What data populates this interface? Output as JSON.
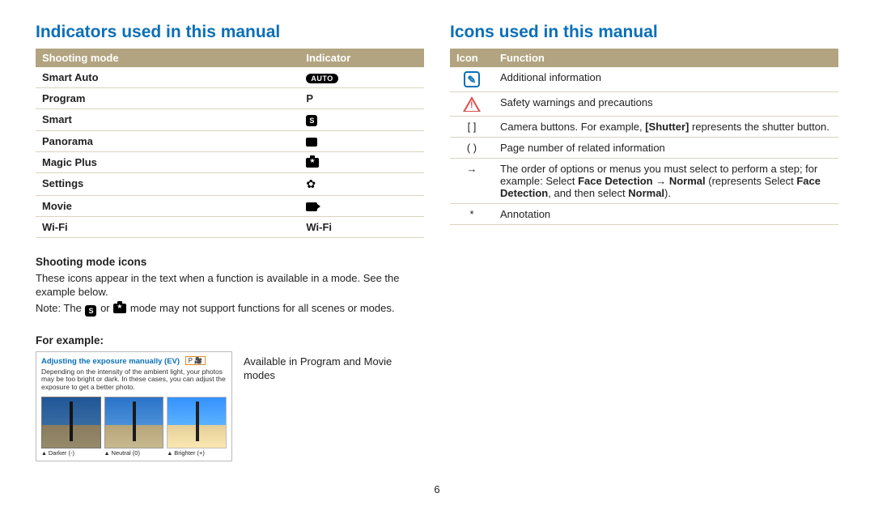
{
  "page_number": "6",
  "left": {
    "title": "Indicators used in this manual",
    "table_headers": {
      "c1": "Shooting mode",
      "c2": "Indicator"
    },
    "rows": [
      {
        "mode": "Smart Auto",
        "indicator_type": "auto",
        "indicator_text": "AUTO"
      },
      {
        "mode": "Program",
        "indicator_type": "text",
        "indicator_text": "P"
      },
      {
        "mode": "Smart",
        "indicator_type": "s-icon",
        "indicator_text": "S"
      },
      {
        "mode": "Panorama",
        "indicator_type": "pano-icon"
      },
      {
        "mode": "Magic Plus",
        "indicator_type": "camera-icon"
      },
      {
        "mode": "Settings",
        "indicator_type": "gear-icon"
      },
      {
        "mode": "Movie",
        "indicator_type": "movie-icon"
      },
      {
        "mode": "Wi-Fi",
        "indicator_type": "text",
        "indicator_text": "Wi-Fi"
      }
    ],
    "sub_heading": "Shooting mode icons",
    "body1": "These icons appear in the text when a function is available in a mode. See the example below.",
    "body2_prefix": "Note: The ",
    "body2_suffix": " mode may not support functions for all scenes or modes.",
    "body2_joiner": " or ",
    "for_example_label": "For example:",
    "example": {
      "header": "Adjusting the exposure manually (EV)",
      "tag_text": "P  🎥",
      "desc": "Depending on the intensity of the ambient light, your photos may be too bright or dark. In these cases, you can adjust the exposure to get a better photo.",
      "thumbs": [
        {
          "caption": "Darker (-)"
        },
        {
          "caption": "Neutral (0)"
        },
        {
          "caption": "Brighter (+)"
        }
      ],
      "callout": "Available in Program and Movie modes"
    }
  },
  "right": {
    "title": "Icons used in this manual",
    "table_headers": {
      "c1": "Icon",
      "c2": "Function"
    },
    "rows": [
      {
        "icon": "info",
        "func_plain": "Additional information"
      },
      {
        "icon": "warn",
        "func_plain": "Safety warnings and precautions"
      },
      {
        "icon": "brackets",
        "glyph": "[  ]",
        "func_rich": [
          {
            "t": "Camera buttons. For example, "
          },
          {
            "t": "[Shutter]",
            "b": true
          },
          {
            "t": " represents the shutter button."
          }
        ]
      },
      {
        "icon": "parens",
        "glyph": "(  )",
        "func_plain": "Page number of related information"
      },
      {
        "icon": "arrow",
        "glyph": "→",
        "func_rich": [
          {
            "t": "The order of options or menus you must select to perform a step; for example: Select "
          },
          {
            "t": "Face Detection",
            "b": true
          },
          {
            "t": " → "
          },
          {
            "t": "Normal",
            "b": true
          },
          {
            "t": " (represents Select "
          },
          {
            "t": "Face Detection",
            "b": true
          },
          {
            "t": ", and then select "
          },
          {
            "t": "Normal",
            "b": true
          },
          {
            "t": ")."
          }
        ]
      },
      {
        "icon": "star",
        "glyph": "*",
        "func_plain": "Annotation"
      }
    ]
  }
}
